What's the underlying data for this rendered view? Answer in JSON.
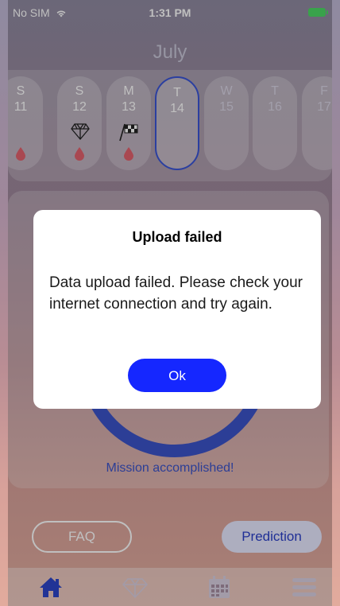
{
  "status_bar": {
    "carrier": "No SIM",
    "time": "1:31 PM"
  },
  "calendar": {
    "month": "July",
    "days": [
      {
        "name": "S",
        "num": "11"
      },
      {
        "name": "S",
        "num": "12"
      },
      {
        "name": "M",
        "num": "13"
      },
      {
        "name": "T",
        "num": "14"
      },
      {
        "name": "W",
        "num": "15"
      },
      {
        "name": "T",
        "num": "16"
      },
      {
        "name": "F",
        "num": "17"
      }
    ]
  },
  "main": {
    "mission_text": "Mission accomplished!"
  },
  "buttons": {
    "faq": "FAQ",
    "prediction": "Prediction"
  },
  "tabbar": {
    "icons": [
      "home-icon",
      "diamond-icon",
      "calendar-icon",
      "menu-icon"
    ]
  },
  "dialog": {
    "title": "Upload failed",
    "message": "Data upload failed. Please check your internet connection and try again.",
    "ok_label": "Ok"
  },
  "colors": {
    "accent": "#1527ff",
    "ring": "#3b53c8",
    "battery": "#4cd964"
  }
}
